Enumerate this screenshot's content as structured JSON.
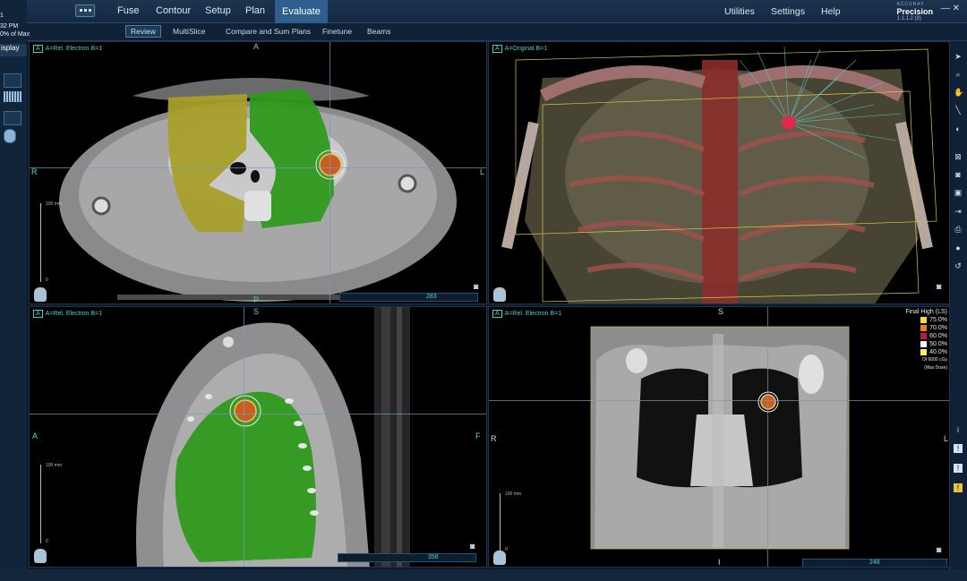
{
  "app": {
    "nav": [
      "Fuse",
      "Contour",
      "Setup",
      "Plan",
      "Evaluate"
    ],
    "active_nav": "Evaluate",
    "utilities": [
      "Utilities",
      "Settings",
      "Help"
    ],
    "brand_small": "ACCURAY",
    "brand_name": "Precision",
    "version": "1.1.1.2 (8)"
  },
  "subtabs": [
    "Review",
    "MultiSlice",
    "Compare and Sum Plans",
    "Finetune",
    "Beams"
  ],
  "left_panel": {
    "time": "32 PM",
    "dose_max": "0% of Max",
    "display": "isplay"
  },
  "viewports": {
    "axial": {
      "label": "A=Rel. Electron B=1",
      "orient_top": "A",
      "orient_left": "R",
      "orient_right": "L",
      "orient_bottom": "P",
      "scale_top": "100 mm",
      "scale_bottom": "0",
      "slice": "283"
    },
    "render3d": {
      "label": "A=Original B=1"
    },
    "sagittal": {
      "label": "A=Rel. Electron B=1",
      "orient_top": "S",
      "orient_left": "A",
      "orient_right": "F",
      "orient_bottom": "I",
      "scale_top": "100 mm",
      "scale_bottom": "0",
      "slice": "356"
    },
    "coronal": {
      "label": "A=Rel. Electron B=1",
      "orient_top": "S",
      "orient_left": "R",
      "orient_right": "L",
      "orient_bottom": "I",
      "scale_top": "100 mm",
      "scale_bottom": "0",
      "slice": "248"
    }
  },
  "dose_legend": {
    "title": "Final High (LS)",
    "levels": [
      {
        "label": "75.0%",
        "color": "#f3e02a"
      },
      {
        "label": "70.0%",
        "color": "#f07a1c"
      },
      {
        "label": "60.0%",
        "color": "#c3164d"
      },
      {
        "label": "50.0%",
        "color": "#f5f5f5"
      },
      {
        "label": "40.0%",
        "color": "#ffef5a"
      }
    ],
    "footer1": "Of 6000 cGy",
    "footer2": "(Max Dose)"
  },
  "colors": {
    "lung_left": "#2f9a1e",
    "lung_right": "#8a8a18",
    "tumor": "#d8752c",
    "accent": "#2f5f8d"
  }
}
